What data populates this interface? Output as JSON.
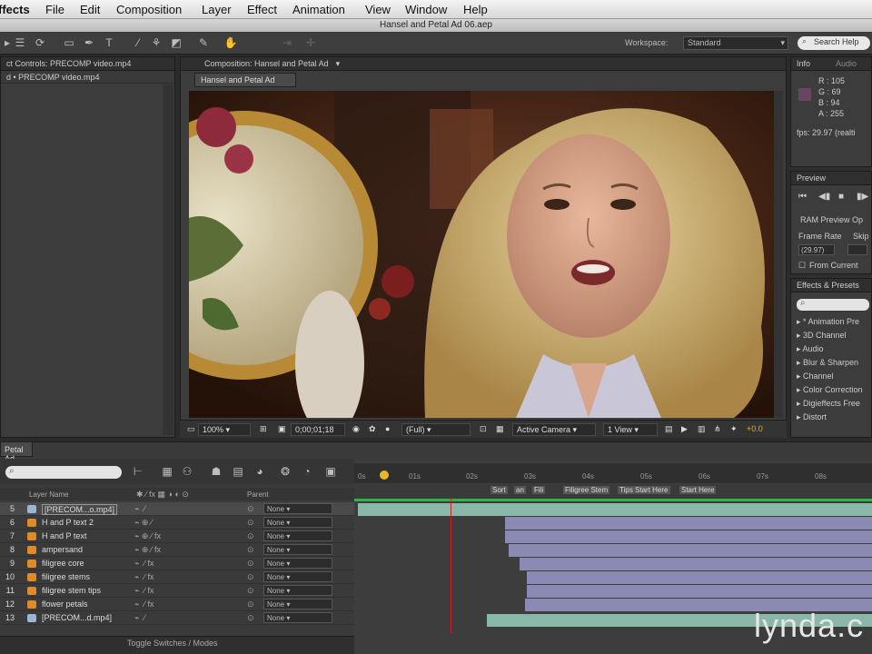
{
  "menubar": {
    "items": [
      "ffects",
      "File",
      "Edit",
      "Composition",
      "Layer",
      "Effect",
      "Animation",
      "View",
      "Window",
      "Help"
    ]
  },
  "window": {
    "title": "Hansel and Petal Ad 06.aep"
  },
  "toolbar": {
    "workspace_label": "Workspace:",
    "workspace_value": "Standard",
    "search_placeholder": "Search Help"
  },
  "effect_controls": {
    "tab": "ct Controls: PRECOMP video.mp4",
    "subtitle": "d • PRECOMP video.mp4"
  },
  "composition": {
    "tab": "Composition: Hansel and Petal Ad",
    "sub_tab": "Hansel and Petal Ad",
    "footer": {
      "zoom": "100%",
      "timecode": "0;00;01;18",
      "resolution": "(Full)",
      "camera": "Active Camera",
      "view": "1 View",
      "exposure": "+0.0"
    }
  },
  "info": {
    "tabs": [
      "Info",
      "Audio"
    ],
    "r": "R : 105",
    "g": "G : 69",
    "b": "B : 94",
    "a": "A : 255",
    "fps": "fps: 29.97 (realti",
    "swatch_color": "#694 55e"
  },
  "preview": {
    "tab": "Preview",
    "ram_label": "RAM Preview Op",
    "frame_rate_label": "Frame Rate",
    "skip_label": "Skip",
    "frame_rate_value": "(29.97)",
    "from_current": "From Current"
  },
  "effects_presets": {
    "tab": "Effects & Presets",
    "items": [
      "* Animation Pre",
      "3D Channel",
      "Audio",
      "Blur & Sharpen",
      "Channel",
      "Color Correction",
      "Digieffects Free",
      "Distort"
    ]
  },
  "timeline": {
    "tab": "Petal Ad",
    "header_layer_name": "Layer Name",
    "header_parent": "Parent",
    "layers": [
      {
        "num": "5",
        "name": "[PRECOM...o.mp4]",
        "parent": "None",
        "fx": ""
      },
      {
        "num": "6",
        "name": "H and P text 2",
        "parent": "None",
        "fx": ""
      },
      {
        "num": "7",
        "name": "H and P text",
        "parent": "None",
        "fx": "fx"
      },
      {
        "num": "8",
        "name": "ampersand",
        "parent": "None",
        "fx": "fx"
      },
      {
        "num": "9",
        "name": "filigree core",
        "parent": "None",
        "fx": "fx"
      },
      {
        "num": "10",
        "name": "filigree stems",
        "parent": "None",
        "fx": "fx"
      },
      {
        "num": "11",
        "name": "filigree stem tips",
        "parent": "None",
        "fx": "fx"
      },
      {
        "num": "12",
        "name": "flower petals",
        "parent": "None",
        "fx": "fx"
      },
      {
        "num": "13",
        "name": "[PRECOM...d.mp4]",
        "parent": "None",
        "fx": ""
      }
    ],
    "ruler_ticks": [
      "0s",
      "01s",
      "02s",
      "03s",
      "04s",
      "05s",
      "06s",
      "07s",
      "08s"
    ],
    "markers": [
      "Sort",
      "an",
      "Fili",
      "Filigree Stem",
      "Tips Start Here",
      "Start Here"
    ],
    "bottom_label": "Toggle Switches / Modes"
  },
  "watermark": "lynda.c"
}
